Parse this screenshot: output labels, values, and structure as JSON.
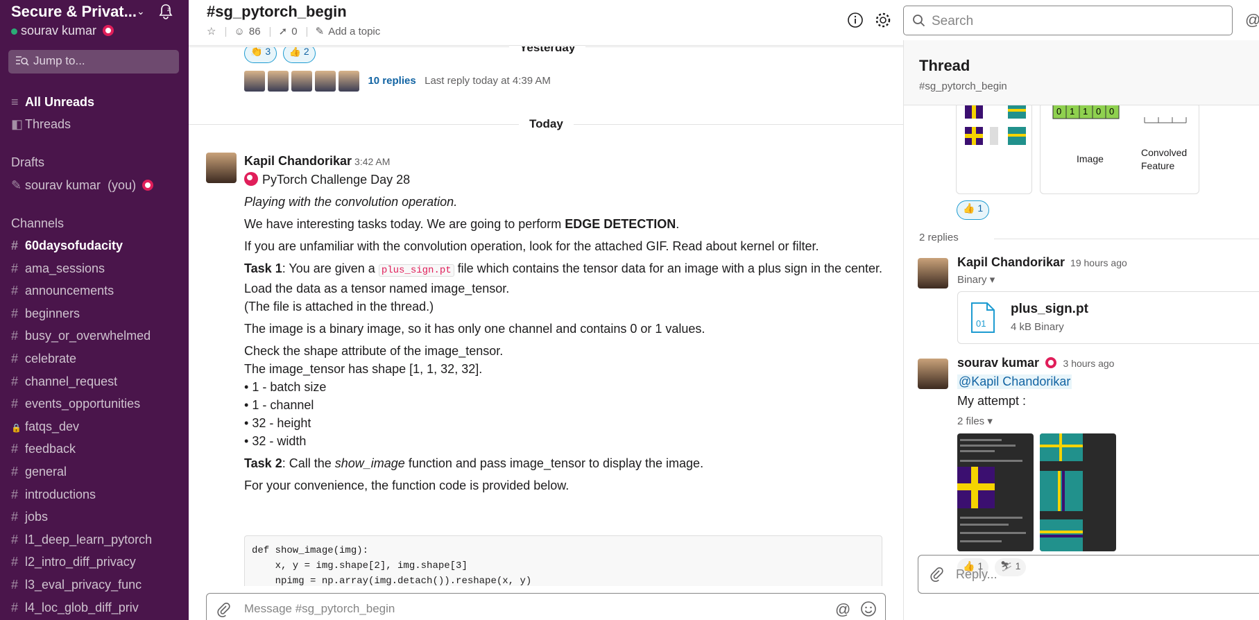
{
  "workspace": {
    "name": "Secure & Privat...",
    "user": "sourav kumar"
  },
  "sidebar": {
    "jump_placeholder": "Jump to...",
    "all_unreads": "All Unreads",
    "threads": "Threads",
    "drafts_heading": "Drafts",
    "draft_user": "sourav kumar",
    "draft_you": "(you)",
    "channels_heading": "Channels",
    "channels": [
      {
        "name": "60daysofudacity",
        "bold": true,
        "locked": false
      },
      {
        "name": "ama_sessions",
        "bold": false,
        "locked": false
      },
      {
        "name": "announcements",
        "bold": false,
        "locked": false
      },
      {
        "name": "beginners",
        "bold": false,
        "locked": false
      },
      {
        "name": "busy_or_overwhelmed",
        "bold": false,
        "locked": false
      },
      {
        "name": "celebrate",
        "bold": false,
        "locked": false
      },
      {
        "name": "channel_request",
        "bold": false,
        "locked": false
      },
      {
        "name": "events_opportunities",
        "bold": false,
        "locked": false
      },
      {
        "name": "fatqs_dev",
        "bold": false,
        "locked": true
      },
      {
        "name": "feedback",
        "bold": false,
        "locked": false
      },
      {
        "name": "general",
        "bold": false,
        "locked": false
      },
      {
        "name": "introductions",
        "bold": false,
        "locked": false
      },
      {
        "name": "jobs",
        "bold": false,
        "locked": false
      },
      {
        "name": "l1_deep_learn_pytorch",
        "bold": false,
        "locked": false
      },
      {
        "name": "l2_intro_diff_privacy",
        "bold": false,
        "locked": false
      },
      {
        "name": "l3_eval_privacy_func",
        "bold": false,
        "locked": false
      },
      {
        "name": "l4_loc_glob_diff_priv",
        "bold": false,
        "locked": false
      }
    ]
  },
  "channel": {
    "title": "#sg_pytorch_begin",
    "members": "86",
    "pins": "0",
    "add_topic": "Add a topic",
    "search_placeholder": "Search"
  },
  "messages": {
    "reaction1_count": "3",
    "reaction2_count": "2",
    "replies_link": "10 replies",
    "last_reply": "Last reply today at 4:39 AM",
    "yesterday": "Yesterday",
    "today": "Today",
    "author": "Kapil Chandorikar",
    "time": "3:42 AM",
    "challenge_title": "PyTorch Challenge Day 28",
    "intro_italic": "Playing with the convolution operation.",
    "line1_a": "We have interesting tasks today. We are going to perform ",
    "line1_b": "EDGE DETECTION",
    "line1_c": ".",
    "line2": "If you are unfamiliar with the convolution operation, look for the attached GIF. Read about kernel or filter.",
    "task1_label": "Task 1",
    "task1_a": ": You are given a ",
    "task1_code": "plus_sign.pt",
    "task1_b": " file which contains the tensor data for an image with a plus sign in the center. Load the data as a tensor named image_tensor.",
    "task1_c": "(The file is attached in the thread.)",
    "binary_line": "The image is a binary image, so it has only one channel and contains 0 or 1 values.",
    "shape_1": "Check the shape attribute of the image_tensor.",
    "shape_2": "The image_tensor has shape [1, 1, 32, 32].",
    "bullets": [
      "1 - batch size",
      "1 - channel",
      "32 - height",
      "32 - width"
    ],
    "task2_label": "Task 2",
    "task2_a": ": Call the ",
    "task2_fn": "show_image",
    "task2_b": " function and pass image_tensor to display the image.",
    "convenience": "For your convenience, the function code is provided below.",
    "code": "def show_image(img):\n    x, y = img.shape[2], img.shape[3]\n    npimg = np.array(img.detach()).reshape(x, y)",
    "composer_placeholder": "Message #sg_pytorch_begin"
  },
  "thread": {
    "title": "Thread",
    "channel": "#sg_pytorch_begin",
    "grid_values": [
      "0",
      "1",
      "1",
      "0",
      "0"
    ],
    "image_label": "Image",
    "convolved_label": "Convolved Feature",
    "thumbs_count": "1",
    "replies_count": "2 replies",
    "reply1_author": "Kapil Chandorikar",
    "reply1_time": "19 hours ago",
    "reply1_binary": "Binary",
    "file_name": "plus_sign.pt",
    "file_meta": "4 kB Binary",
    "reply2_author": "sourav kumar",
    "reply2_time": "3 hours ago",
    "reply2_mention": "@Kapil Chandorikar",
    "reply2_text": "My attempt :",
    "reply2_files": "2 files",
    "react1_count": "1",
    "react2_count": "1",
    "reply_placeholder": "Reply..."
  }
}
